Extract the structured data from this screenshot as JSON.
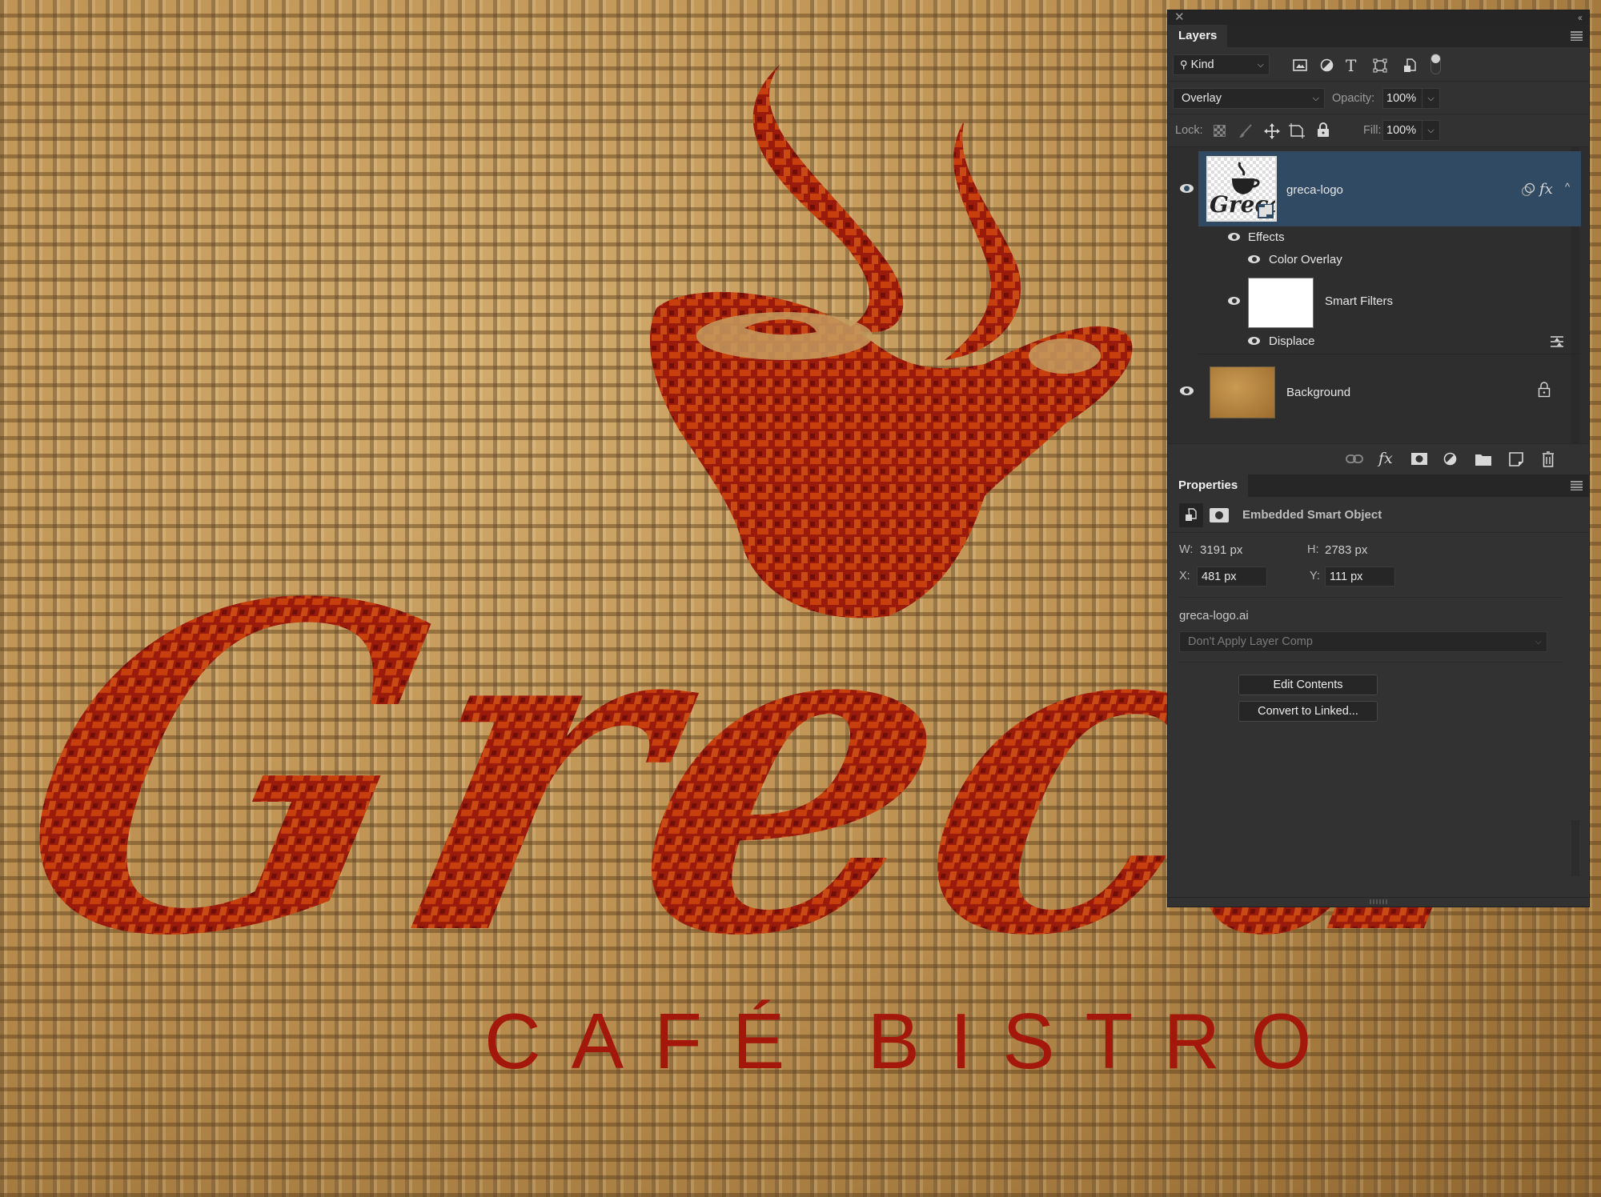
{
  "canvas": {
    "logo_script_text": "Greca",
    "logo_tagline": "CAFÉ BISTRO",
    "colors": {
      "burlap": "#c29a5c",
      "logo_red": "#a0170a",
      "logo_highlight": "#e05a10"
    }
  },
  "panel": {
    "close_icon": "close-icon",
    "collapse_icon": "double-chevron-icon"
  },
  "layers": {
    "tab_label": "Layers",
    "filter": {
      "label": "Kind",
      "icons": [
        "image-filter-icon",
        "adjustment-filter-icon",
        "type-filter-icon",
        "shape-filter-icon",
        "smart-object-filter-icon",
        "filter-toggle"
      ]
    },
    "blend_mode": "Overlay",
    "opacity_label": "Opacity:",
    "opacity_value": "100%",
    "lock_label": "Lock:",
    "fill_label": "Fill:",
    "fill_value": "100%",
    "items": [
      {
        "name": "greca-logo",
        "selected": true,
        "visible": true,
        "type": "smart-object",
        "badges": [
          "link-icon",
          "fx"
        ]
      },
      {
        "name": "Effects",
        "visible": true,
        "indent": 1
      },
      {
        "name": "Color Overlay",
        "visible": true,
        "indent": 2
      },
      {
        "name": "Smart Filters",
        "visible": true,
        "indent": 1
      },
      {
        "name": "Displace",
        "visible": true,
        "indent": 2
      },
      {
        "name": "Background",
        "selected": false,
        "visible": true,
        "locked": true
      }
    ],
    "fx_label": "fx",
    "footer_icons": [
      "link-layers-icon",
      "add-style-icon",
      "add-mask-icon",
      "new-adjustment-icon",
      "new-group-icon",
      "new-layer-icon",
      "delete-icon"
    ]
  },
  "properties": {
    "tab_label": "Properties",
    "object_type": "Embedded Smart Object",
    "w_label": "W:",
    "w_value": "3191 px",
    "h_label": "H:",
    "h_value": "2783 px",
    "x_label": "X:",
    "x_value": "481 px",
    "y_label": "Y:",
    "y_value": "111 px",
    "filename": "greca-logo.ai",
    "layer_comp": "Don't Apply Layer Comp",
    "edit_button": "Edit Contents",
    "convert_button": "Convert to Linked..."
  },
  "colors": {
    "panel_bg": "#323232",
    "selected_row": "#2f4a62",
    "text": "#e6e6e6"
  }
}
